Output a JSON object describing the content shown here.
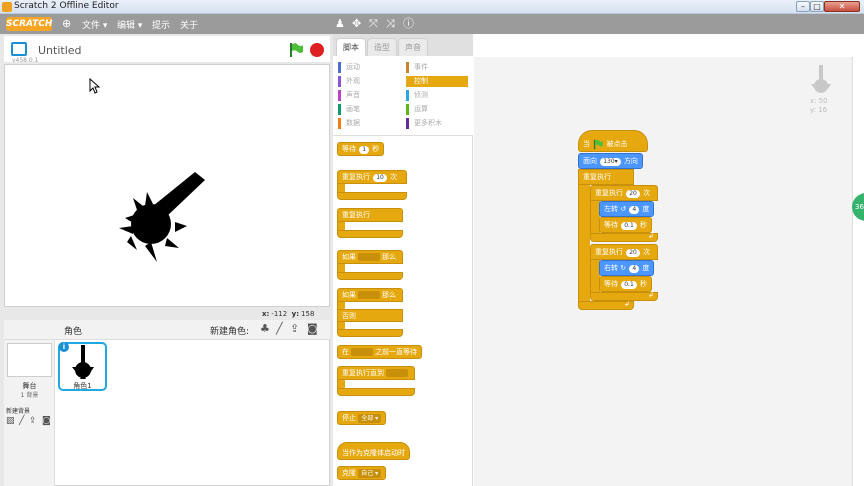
{
  "window": {
    "title": "Scratch 2 Offline Editor",
    "min": "–",
    "max": "□",
    "close": "✕"
  },
  "menubar": {
    "logo": "SCRATCH",
    "file": "文件 ▾",
    "edit": "编辑 ▾",
    "tips": "提示",
    "about": "关于"
  },
  "stage": {
    "project_title": "Untitled",
    "version": "v458.0.1",
    "x_label": "x:",
    "x_value": "-112",
    "y_label": "y:",
    "y_value": "158"
  },
  "sprites": {
    "label": "角色",
    "new_sprite": "新建角色:",
    "stage_name": "舞台",
    "stage_bg_count": "1 背景",
    "new_backdrop": "新建背景",
    "sprite_name": "角色1"
  },
  "tabs": [
    "脚本",
    "造型",
    "声音"
  ],
  "categories": [
    {
      "label": "运动",
      "color": "#4a6cd4"
    },
    {
      "label": "事件",
      "color": "#c88330"
    },
    {
      "label": "外观",
      "color": "#8a55d7"
    },
    {
      "label": "控制",
      "color": "#e1a91a"
    },
    {
      "label": "声音",
      "color": "#bb42c3"
    },
    {
      "label": "侦测",
      "color": "#2ca5e2"
    },
    {
      "label": "画笔",
      "color": "#0e9a6c"
    },
    {
      "label": "运算",
      "color": "#5cb712"
    },
    {
      "label": "数据",
      "color": "#ee7d16"
    },
    {
      "label": "更多积木",
      "color": "#632d99"
    }
  ],
  "palette": {
    "wait": "等待",
    "wait_num": "1",
    "wait_unit": "秒",
    "repeat": "重复执行",
    "repeat_num": "10",
    "repeat_unit": "次",
    "forever": "重复执行",
    "if": "如果",
    "then": "那么",
    "if2": "如果",
    "then2": "那么",
    "else": "否则",
    "wait_until_pre": "在",
    "wait_until_post": "之前一直等待",
    "repeat_until": "重复执行直到",
    "stop": "停止",
    "stop_opt": "全部 ▾",
    "clone_start": "当作为克隆体启动时",
    "clone": "克隆",
    "clone_opt": "自己 ▾"
  },
  "script": {
    "hat_when": "当",
    "hat_clicked": "被点击",
    "point": "面向",
    "point_num": "130▾",
    "point_unit": "方向",
    "forever": "重复执行",
    "rep1": "重复执行",
    "rep1_num": "20",
    "rep1_unit": "次",
    "turn_left": "左转",
    "turn_left_num": "4",
    "turn_left_unit": "度",
    "wait1": "等待",
    "wait1_num": "0.1",
    "wait1_unit": "秒",
    "rep2": "重复执行",
    "rep2_num": "20",
    "rep2_unit": "次",
    "turn_right": "右转",
    "turn_right_num": "4",
    "turn_right_unit": "度",
    "wait2": "等待",
    "wait2_num": "0.1",
    "wait2_unit": "秒",
    "ghost_x": "x: 50",
    "ghost_y": "y: 16",
    "scroll_badge": "36"
  }
}
